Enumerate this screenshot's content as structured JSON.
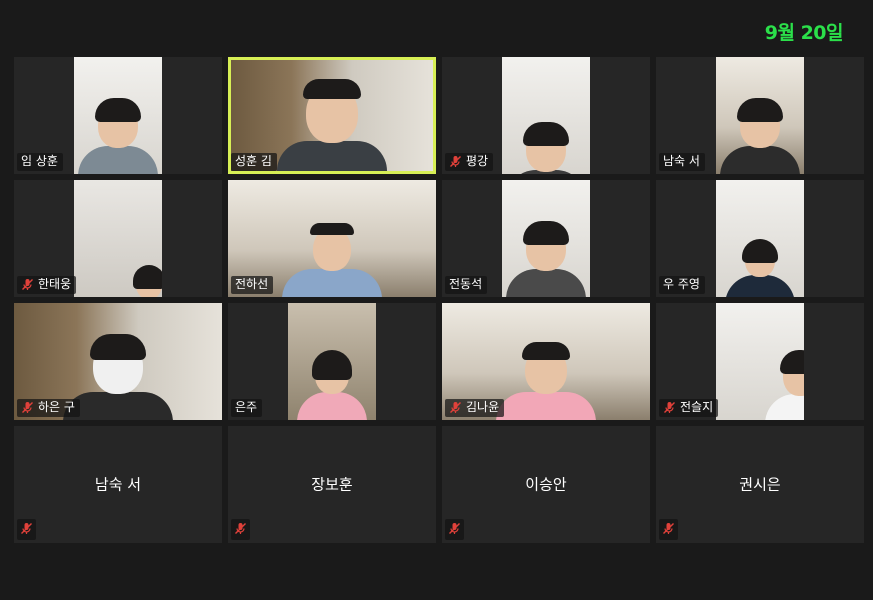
{
  "date_label": "9월 20일",
  "colors": {
    "accent_green": "#2be04a",
    "active_border": "#d7ef55",
    "muted_red": "#e0413a"
  },
  "participants": [
    {
      "name": "임 상훈",
      "muted": false,
      "video": true,
      "active": false
    },
    {
      "name": "성훈 김",
      "muted": false,
      "video": true,
      "active": true
    },
    {
      "name": "평강",
      "muted": true,
      "video": true,
      "active": false
    },
    {
      "name": "남숙 서",
      "muted": false,
      "video": true,
      "active": false
    },
    {
      "name": "한태웅",
      "muted": true,
      "video": true,
      "active": false
    },
    {
      "name": "전하선",
      "muted": false,
      "video": true,
      "active": false
    },
    {
      "name": "전동석",
      "muted": false,
      "video": true,
      "active": false
    },
    {
      "name": "우 주영",
      "muted": false,
      "video": true,
      "active": false
    },
    {
      "name": "하은 구",
      "muted": true,
      "video": true,
      "active": false
    },
    {
      "name": "은주",
      "muted": false,
      "video": true,
      "active": false
    },
    {
      "name": "김나윤",
      "muted": true,
      "video": true,
      "active": false
    },
    {
      "name": "전슬지",
      "muted": true,
      "video": true,
      "active": false
    },
    {
      "name": "남숙 서",
      "muted": true,
      "video": false,
      "active": false
    },
    {
      "name": "장보훈",
      "muted": true,
      "video": false,
      "active": false
    },
    {
      "name": "이승안",
      "muted": true,
      "video": false,
      "active": false
    },
    {
      "name": "권시은",
      "muted": true,
      "video": false,
      "active": false
    }
  ]
}
